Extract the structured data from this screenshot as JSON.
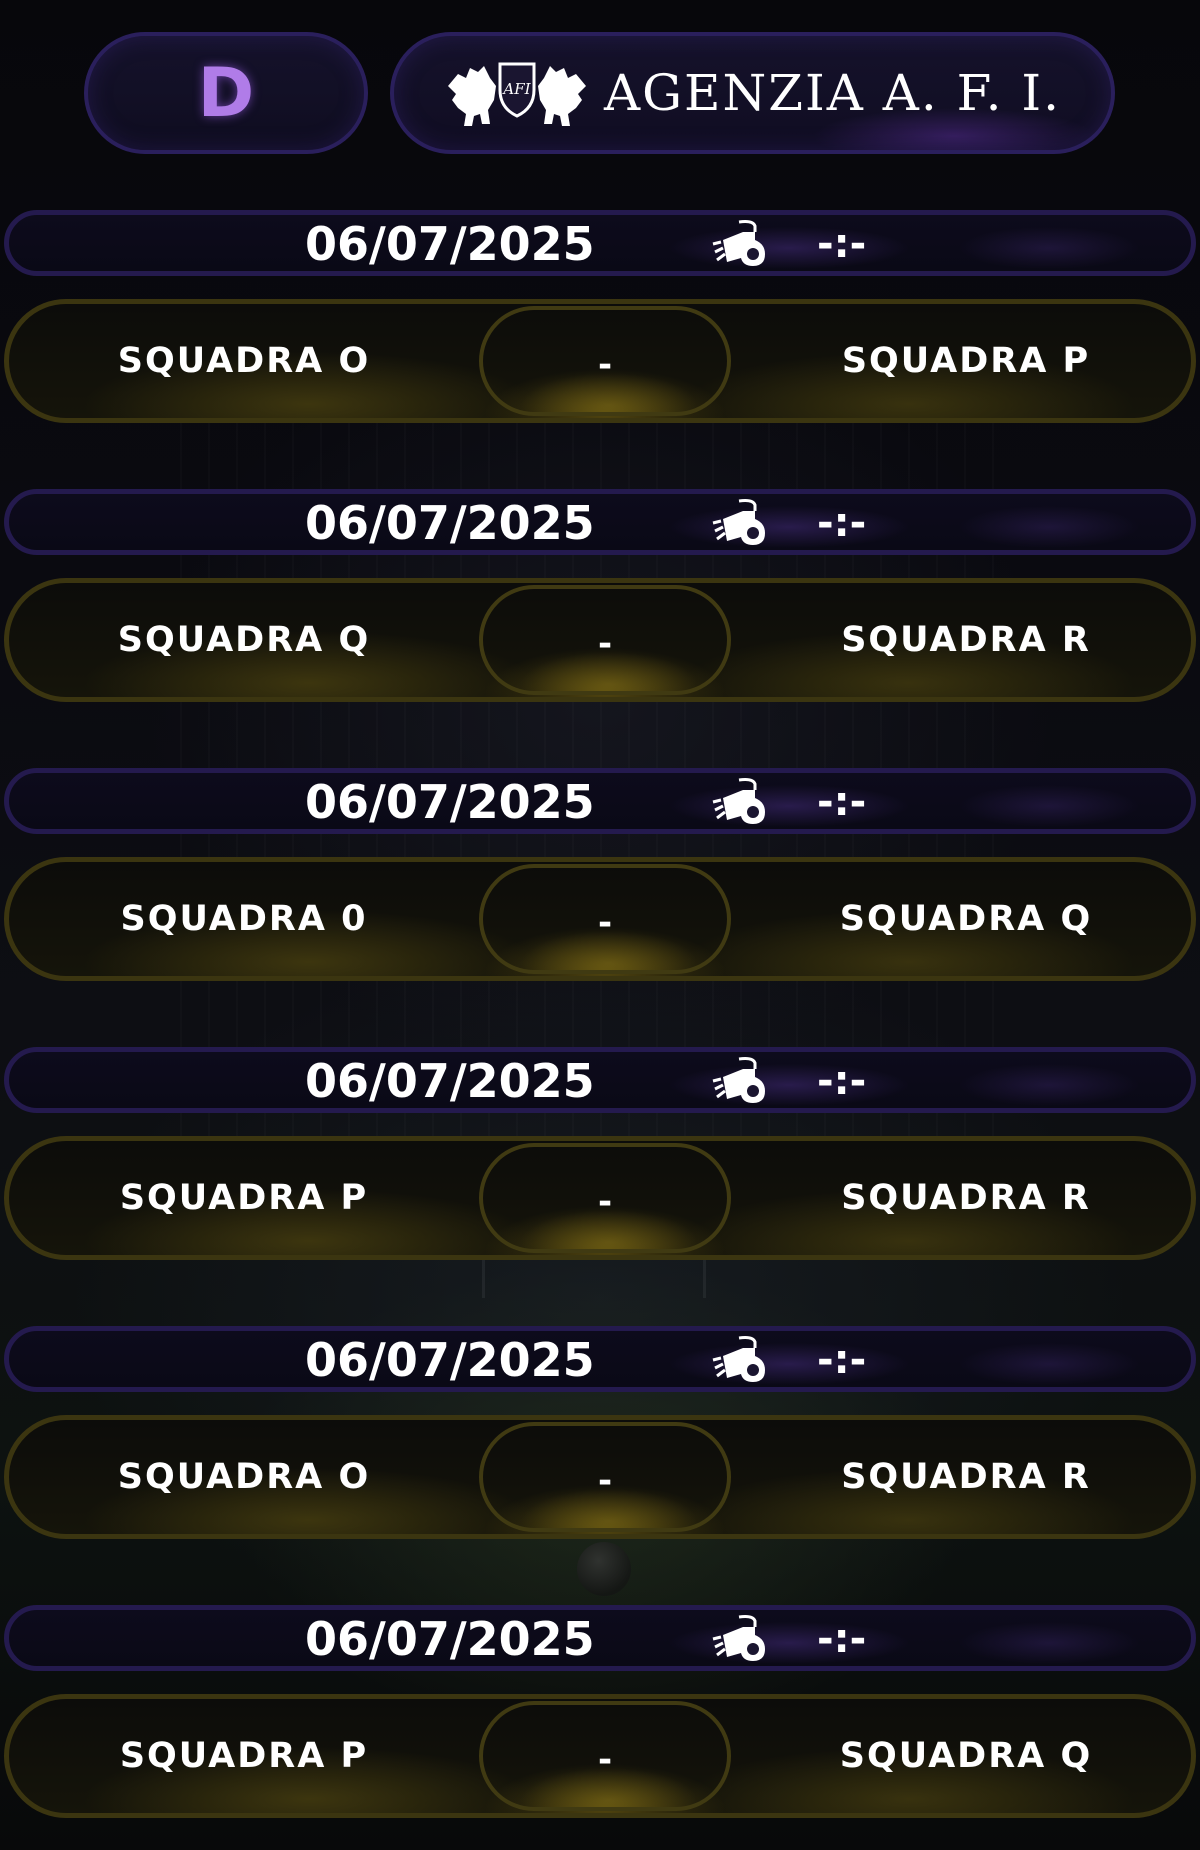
{
  "header": {
    "group_letter": "D",
    "brand_name": "AGENZIA A. F. I.",
    "logo_text": "AFI"
  },
  "colors": {
    "group_letter": "#b07ce8",
    "date_bar_border": "#241a4e",
    "match_bar_border": "#3b3510",
    "text": "#ffffff"
  },
  "matches": [
    {
      "date": "06/07/2025",
      "time": "-:-",
      "home": "SQUADRA O",
      "away": "SQUADRA P",
      "score": "-",
      "icon": "whistle-icon"
    },
    {
      "date": "06/07/2025",
      "time": "-:-",
      "home": "SQUADRA Q",
      "away": "SQUADRA R",
      "score": "-",
      "icon": "whistle-icon"
    },
    {
      "date": "06/07/2025",
      "time": "-:-",
      "home": "SQUADRA 0",
      "away": "SQUADRA Q",
      "score": "-",
      "icon": "whistle-icon"
    },
    {
      "date": "06/07/2025",
      "time": "-:-",
      "home": "SQUADRA P",
      "away": "SQUADRA R",
      "score": "-",
      "icon": "whistle-icon"
    },
    {
      "date": "06/07/2025",
      "time": "-:-",
      "home": "SQUADRA O",
      "away": "SQUADRA R",
      "score": "-",
      "icon": "whistle-icon"
    },
    {
      "date": "06/07/2025",
      "time": "-:-",
      "home": "SQUADRA P",
      "away": "SQUADRA Q",
      "score": "-",
      "icon": "whistle-icon"
    }
  ]
}
